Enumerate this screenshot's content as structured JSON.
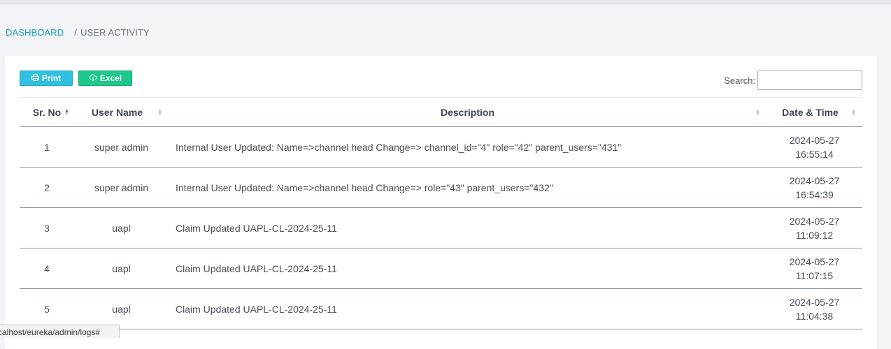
{
  "breadcrumb": {
    "home": "DASHBOARD",
    "separator": "/",
    "current": "USER ACTIVITY"
  },
  "toolbar": {
    "print_label": "Print",
    "excel_label": "Excel",
    "print_icon": "printer-icon",
    "excel_icon": "cloud-download-icon"
  },
  "search": {
    "label": "Search:",
    "value": "",
    "placeholder": ""
  },
  "table": {
    "headers": [
      "Sr. No",
      "User Name",
      "Description",
      "Date & Time"
    ],
    "rows": [
      {
        "sr": "1",
        "user": "super admin",
        "desc": "Internal User Updated: Name=>channel head Change=> channel_id=\"4\" role=\"42\" parent_users=\"431\"",
        "date": "2024-05-27",
        "time": "16:55:14"
      },
      {
        "sr": "2",
        "user": "super admin",
        "desc": "Internal User Updated: Name=>channel head Change=> role=\"43\" parent_users=\"432\"",
        "date": "2024-05-27",
        "time": "16:54:39"
      },
      {
        "sr": "3",
        "user": "uapl",
        "desc": "Claim Updated UAPL-CL-2024-25-11",
        "date": "2024-05-27",
        "time": "11:09:12"
      },
      {
        "sr": "4",
        "user": "uapl",
        "desc": "Claim Updated UAPL-CL-2024-25-11",
        "date": "2024-05-27",
        "time": "11:07:15"
      },
      {
        "sr": "5",
        "user": "uapl",
        "desc": "Claim Updated UAPL-CL-2024-25-11",
        "date": "2024-05-27",
        "time": "11:04:38"
      }
    ]
  },
  "status_bar": {
    "url": "calhost/eureka/admin/logs#"
  },
  "colors": {
    "accent": "#17a2b8",
    "print_button": "#31c0e0",
    "excel_button": "#1cc88a"
  }
}
